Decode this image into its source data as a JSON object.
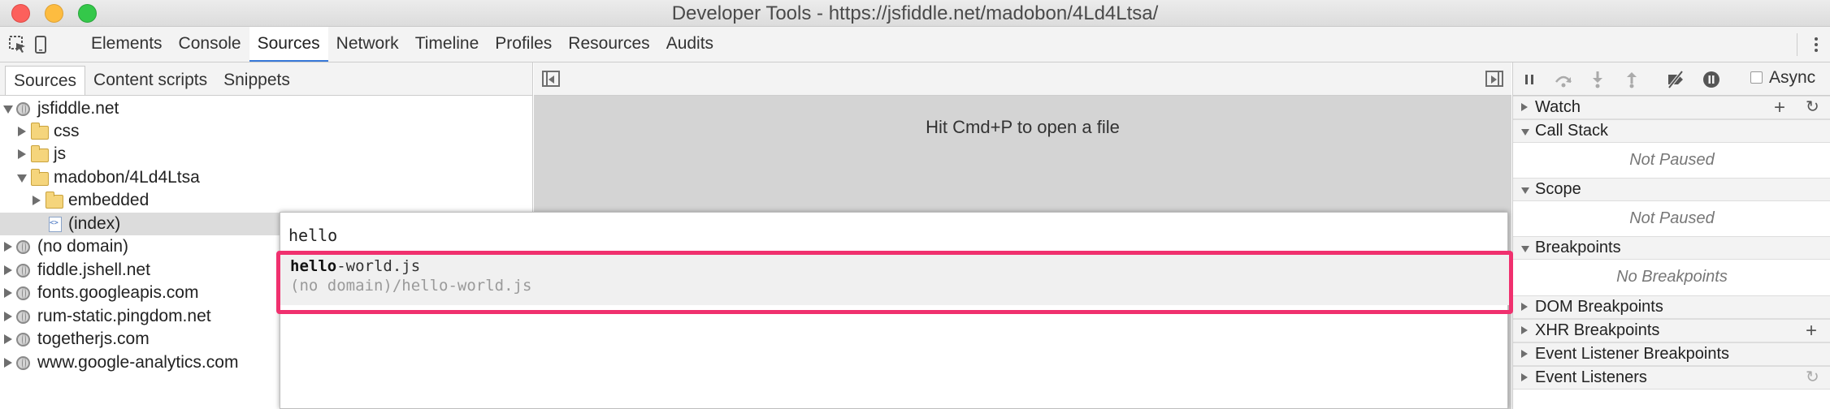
{
  "window": {
    "title": "Developer Tools - https://jsfiddle.net/madobon/4Ld4Ltsa/"
  },
  "toolbar": {
    "tabs": [
      "Elements",
      "Console",
      "Sources",
      "Network",
      "Timeline",
      "Profiles",
      "Resources",
      "Audits"
    ],
    "active_tab": "Sources"
  },
  "navigator": {
    "tabs": [
      "Sources",
      "Content scripts",
      "Snippets"
    ],
    "active_tab": "Sources",
    "tree": [
      {
        "label": "jsfiddle.net",
        "type": "domain",
        "expanded": true
      },
      {
        "label": "css",
        "type": "folder"
      },
      {
        "label": "js",
        "type": "folder"
      },
      {
        "label": "madobon/4Ld4Ltsa",
        "type": "folder",
        "expanded": true
      },
      {
        "label": "embedded",
        "type": "folder"
      },
      {
        "label": "(index)",
        "type": "file",
        "selected": true
      },
      {
        "label": "(no domain)",
        "type": "domain"
      },
      {
        "label": "fiddle.jshell.net",
        "type": "domain"
      },
      {
        "label": "fonts.googleapis.com",
        "type": "domain"
      },
      {
        "label": "rum-static.pingdom.net",
        "type": "domain"
      },
      {
        "label": "togetherjs.com",
        "type": "domain"
      },
      {
        "label": "www.google-analytics.com",
        "type": "domain"
      }
    ]
  },
  "editor": {
    "hint": "Hit Cmd+P to open a file"
  },
  "quick_open": {
    "query": "hello",
    "result": {
      "match": "hello",
      "rest": "-world.js",
      "path": "(no domain)/hello-world.js"
    },
    "highlight_color": "#f0306e"
  },
  "debugger": {
    "async_label": "Async",
    "sections": {
      "watch": "Watch",
      "call_stack": "Call Stack",
      "call_stack_body": "Not Paused",
      "scope": "Scope",
      "scope_body": "Not Paused",
      "breakpoints": "Breakpoints",
      "breakpoints_body": "No Breakpoints",
      "dom_breakpoints": "DOM Breakpoints",
      "xhr_breakpoints": "XHR Breakpoints",
      "event_listener_breakpoints": "Event Listener Breakpoints",
      "event_listeners": "Event Listeners"
    }
  },
  "colors": {
    "accent": "#3879d9",
    "close": "#fc605c",
    "minimize": "#fdbc40",
    "maximize": "#34c84a"
  }
}
